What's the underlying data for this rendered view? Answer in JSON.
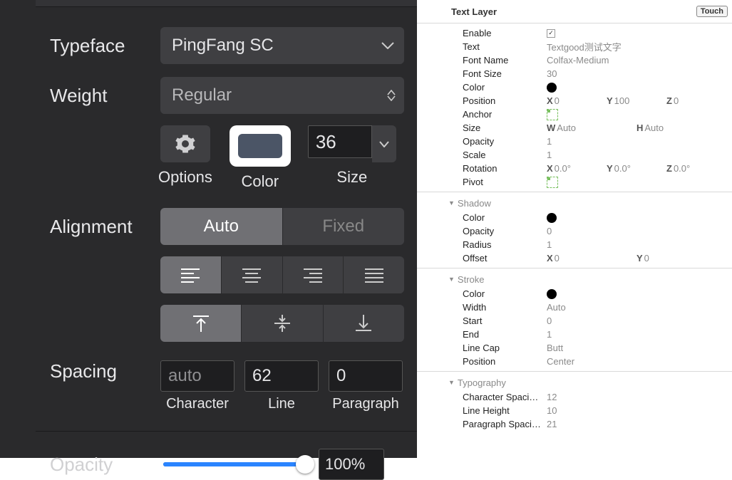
{
  "left": {
    "typeface_label": "Typeface",
    "typeface_value": "PingFang SC",
    "weight_label": "Weight",
    "weight_value": "Regular",
    "options_label": "Options",
    "color_label": "Color",
    "color_swatch": "#4b5566",
    "size_label": "Size",
    "size_value": "36",
    "alignment_label": "Alignment",
    "align_auto": "Auto",
    "align_fixed": "Fixed",
    "spacing_label": "Spacing",
    "char_value": "auto",
    "char_label": "Character",
    "line_value": "62",
    "line_label": "Line",
    "para_value": "0",
    "para_label": "Paragraph",
    "opacity_label": "Opacity",
    "opacity_value": "100%"
  },
  "right": {
    "header": "Text Layer",
    "touch": "Touch",
    "main": {
      "enable_label": "Enable",
      "text_label": "Text",
      "text_value": "Textgood测试文字",
      "fontname_label": "Font Name",
      "fontname_value": "Colfax-Medium",
      "fontsize_label": "Font Size",
      "fontsize_value": "30",
      "color_label": "Color",
      "position_label": "Position",
      "position_x": "0",
      "position_y": "100",
      "position_z": "0",
      "anchor_label": "Anchor",
      "size_label": "Size",
      "size_w": "Auto",
      "size_h": "Auto",
      "opacity_label": "Opacity",
      "opacity_value": "1",
      "scale_label": "Scale",
      "scale_value": "1",
      "rotation_label": "Rotation",
      "rotation_x": "0.0°",
      "rotation_y": "0.0°",
      "rotation_z": "0.0°",
      "pivot_label": "Pivot"
    },
    "shadow": {
      "title": "Shadow",
      "color_label": "Color",
      "opacity_label": "Opacity",
      "opacity_value": "0",
      "radius_label": "Radius",
      "radius_value": "1",
      "offset_label": "Offset",
      "offset_x": "0",
      "offset_y": "0"
    },
    "stroke": {
      "title": "Stroke",
      "color_label": "Color",
      "width_label": "Width",
      "width_value": "Auto",
      "start_label": "Start",
      "start_value": "0",
      "end_label": "End",
      "end_value": "1",
      "linecap_label": "Line Cap",
      "linecap_value": "Butt",
      "position_label": "Position",
      "position_value": "Center"
    },
    "typography": {
      "title": "Typography",
      "charspacing_label": "Character Spaci…",
      "charspacing_value": "12",
      "lineheight_label": "Line Height",
      "lineheight_value": "10",
      "paraspacing_label": "Paragraph Spaci…",
      "paraspacing_value": "21"
    }
  }
}
